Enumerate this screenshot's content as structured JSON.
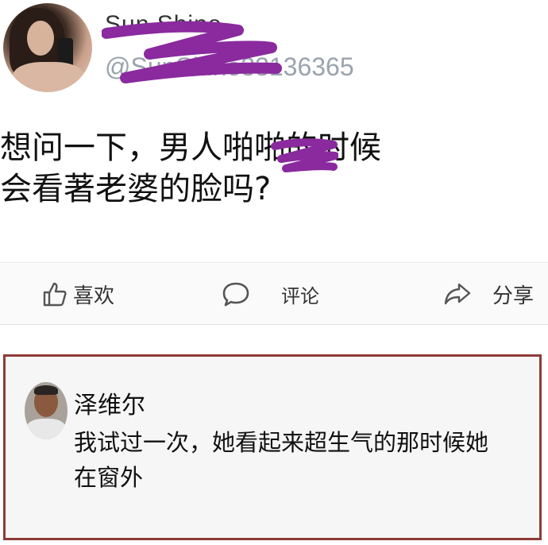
{
  "post": {
    "author_name": "Sun Shine",
    "author_handle": "@SunShine33136365",
    "text_line1": "想问一下，男人啪啪的时候",
    "text_line2": "会看著老婆的脸吗?"
  },
  "actions": {
    "like_label": "喜欢",
    "comment_label": "评论",
    "share_label": "分享"
  },
  "comment": {
    "author_name": "泽维尔",
    "text": "我试过一次，她看起来超生气的那时候她在窗外"
  },
  "colors": {
    "censor_ink": "#8a2a9e",
    "comment_border": "#8e3b36",
    "handle_gray": "#9aa3ad"
  },
  "icons": [
    "thumbs-up-icon",
    "comment-bubble-icon",
    "share-arrow-icon"
  ]
}
